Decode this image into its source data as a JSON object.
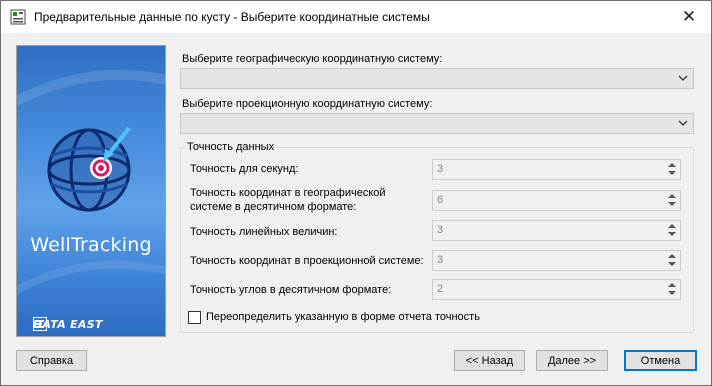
{
  "window": {
    "title": "Предварительные данные по кусту - Выберите координатные системы",
    "close_glyph": "✕"
  },
  "banner": {
    "brand": "WellTracking",
    "vendor": "DATA EAST"
  },
  "form": {
    "geo_label": "Выберите географическую координатную систему:",
    "geo_value": "",
    "proj_label": "Выберите проекционную координатную систему:",
    "proj_value": "",
    "group_title": "Точность данных",
    "fields": [
      {
        "label": "Точность для секунд:",
        "value": "3"
      },
      {
        "label_line1": "Точность  координат  в  географической",
        "label_line2": "системе в десятичном формате:",
        "value": "6"
      },
      {
        "label": "Точность линейных величин:",
        "value": "3"
      },
      {
        "label": "Точность координат в проекционной системе:",
        "value": "3"
      },
      {
        "label": "Точность углов в десятичном формате:",
        "value": "2"
      }
    ],
    "override_label": "Переопределить указанную в форме отчета точность",
    "override_checked": false
  },
  "buttons": {
    "help": "Справка",
    "back": "<< Назад",
    "next": "Далее >>",
    "cancel": "Отмена"
  },
  "colors": {
    "accent": "#0078d7",
    "banner_blue": "#3f86dc",
    "target_red": "#d81b60"
  }
}
